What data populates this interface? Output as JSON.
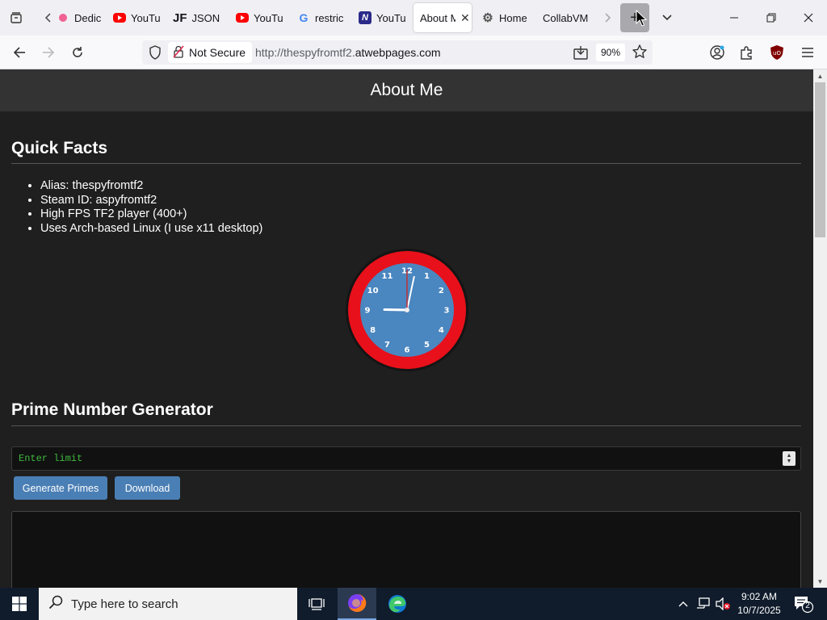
{
  "browser": {
    "tabs": [
      {
        "title": "Dedic",
        "icon": "pink-dot-icon"
      },
      {
        "title": "YouTu",
        "icon": "youtube-icon"
      },
      {
        "title": "JSON",
        "icon": "jf-icon"
      },
      {
        "title": "YouTu",
        "icon": "youtube-icon"
      },
      {
        "title": "restric",
        "icon": "google-icon"
      },
      {
        "title": "YouTu",
        "icon": "italic-n-icon"
      },
      {
        "title": "About M",
        "icon": "none",
        "active": true
      },
      {
        "title": "Home",
        "icon": "gear-icon"
      },
      {
        "title": "CollabVM",
        "icon": "none"
      }
    ],
    "fav_jf": "JF",
    "fav_google": "G",
    "fav_n": "N",
    "not_secure_label": "Not Secure",
    "url_prefix": "http://thespyfromtf2.",
    "url_domain": "atwebpages.com",
    "zoom": "90%"
  },
  "page": {
    "header_title": "About Me",
    "quick_facts_title": "Quick Facts",
    "facts": [
      "Alias: thespyfromtf2",
      "Steam ID: aspyfromtf2",
      "High FPS TF2 player (400+)",
      "Uses Arch-based Linux (I use x11 desktop)"
    ],
    "clock": {
      "numbers": [
        "12",
        "1",
        "2",
        "3",
        "4",
        "5",
        "6",
        "7",
        "8",
        "9",
        "10",
        "11"
      ],
      "time_hours": 9,
      "time_minutes": 2,
      "time_seconds": 0,
      "face_color": "#4a86c0",
      "ring_color": "#e8101a"
    },
    "prime_title": "Prime Number Generator",
    "limit_placeholder": "Enter limit",
    "generate_label": "Generate Primes",
    "download_label": "Download"
  },
  "taskbar": {
    "search_placeholder": "Type here to search",
    "time": "9:02 AM",
    "date": "10/7/2025",
    "notification_count": "2"
  }
}
